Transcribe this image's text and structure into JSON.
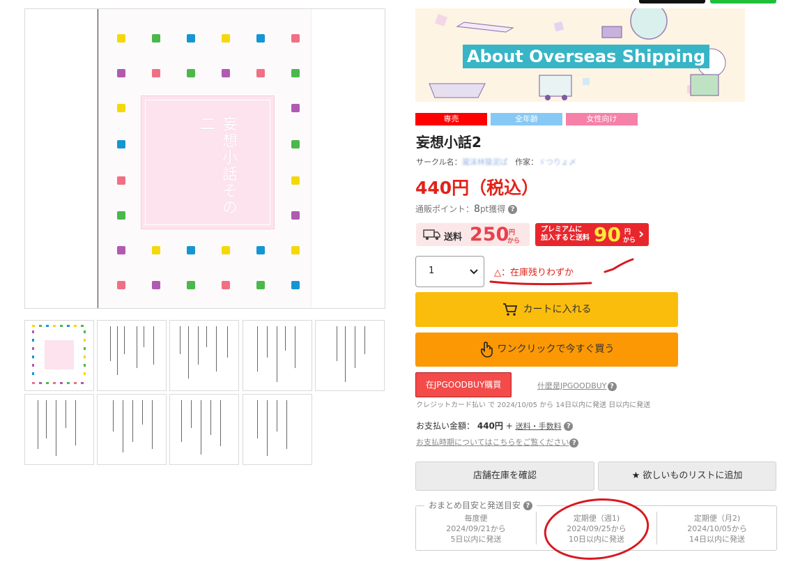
{
  "gallery": {
    "cover_title": "妄想小話その二",
    "thumbnails_count": 9
  },
  "banner": {
    "text": "About Overseas Shipping"
  },
  "tags": [
    {
      "label": "専売",
      "color": "#ff0000"
    },
    {
      "label": "全年齢",
      "color": "#87c9f5"
    },
    {
      "label": "女性向け",
      "color": "#f681a8"
    }
  ],
  "product": {
    "title": "妄想小話2",
    "circle_label": "サークル名：",
    "circle_name": "瀧沫林猿泥ぱ",
    "author_label": "作家：",
    "author_name": "ゞつりょ〆",
    "price": "440円（税込）",
    "points_label": "通販ポイント：",
    "points_value": "8",
    "points_unit": "pt獲得"
  },
  "shipping": {
    "label": "送料",
    "amount": "250",
    "unit_top": "円",
    "unit_bottom": "から",
    "premium_line1": "プレミアムに",
    "premium_line2": "加入すると送料",
    "premium_amount": "90",
    "premium_unit_top": "円",
    "premium_unit_bottom": "から",
    "arrow": "›"
  },
  "purchase": {
    "quantity": "1",
    "stock_symbol": "△",
    "stock_text": "：在庫残りわずか",
    "cart_label": "カートに入れる",
    "oneclick_label": "ワンクリックで今すぐ買う",
    "jpgoodbuy_label": "在JPGOODBUY購買",
    "what_label": "什麼是JPGOODBUY",
    "credit_note": "クレジットカード払い で 2024/10/05 から 14日以内に発送 日以内に発送",
    "payment_label": "お支払い金額：",
    "payment_amount": "440円",
    "payment_plus": "+",
    "payment_fee_link": "送料・手数料",
    "payment_timing_link": "お支払時期についてはこちらをご覧ください"
  },
  "actions": {
    "store_stock": "店舗在庫を確認",
    "wishlist": "欲しいものリストに追加"
  },
  "schedule": {
    "legend": "おまとめ目安と発送目安",
    "columns": [
      {
        "name": "毎度便",
        "date": "2024/09/21から",
        "days": "5日以内に発送"
      },
      {
        "name": "定期便（週1)",
        "date": "2024/09/25から",
        "days": "10日以内に発送"
      },
      {
        "name": "定期便（月2)",
        "date": "2024/10/05から",
        "days": "14日以内に発送"
      }
    ]
  }
}
